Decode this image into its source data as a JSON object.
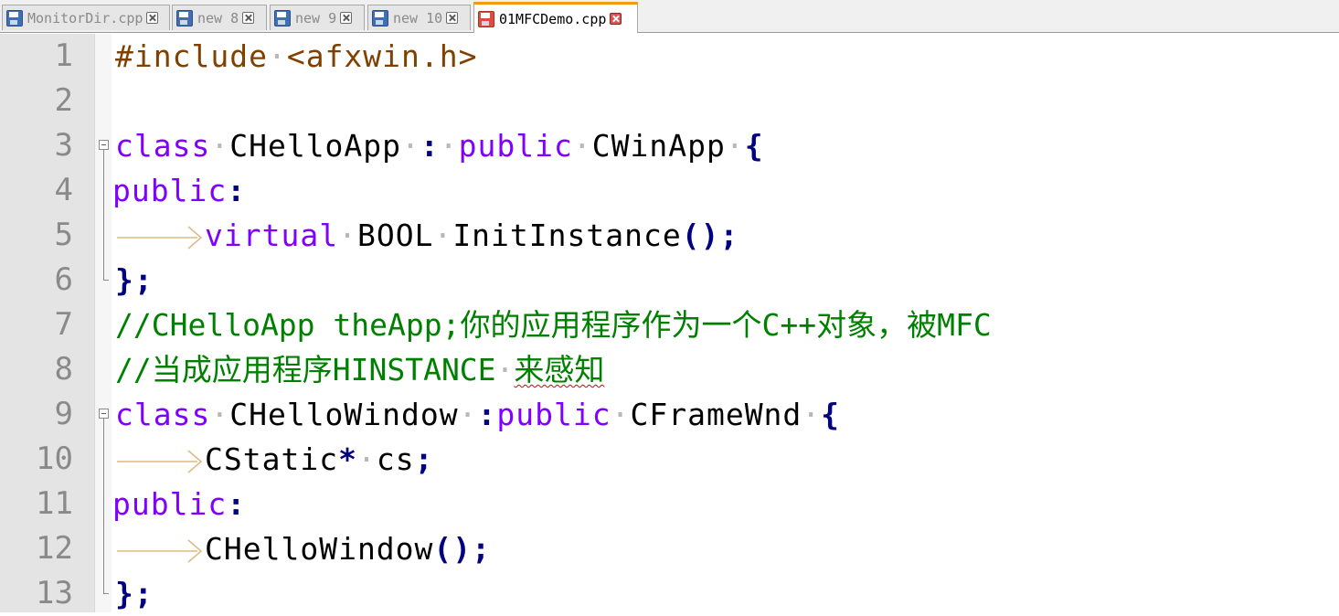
{
  "tabs": [
    {
      "label": "MonitorDir.cpp",
      "icon": "floppy-disk-icon",
      "active": false
    },
    {
      "label": "new 8",
      "icon": "floppy-disk-icon",
      "active": false
    },
    {
      "label": "new 9",
      "icon": "floppy-disk-icon",
      "active": false
    },
    {
      "label": "new 10",
      "icon": "floppy-disk-icon",
      "active": false
    },
    {
      "label": "01MFCDemo.cpp",
      "icon": "floppy-disk-unsaved-icon",
      "active": true
    }
  ],
  "editor": {
    "line_numbers": [
      "1",
      "2",
      "3",
      "4",
      "5",
      "6",
      "7",
      "8",
      "9",
      "10",
      "11",
      "12",
      "13"
    ],
    "line1": {
      "directive": "#include",
      "header": "<afxwin.h>"
    },
    "line3": {
      "kw_class": "class",
      "name": "CHelloApp",
      "colon": ":",
      "kw_public": "public",
      "base": "CWinApp",
      "brace": "{"
    },
    "line4": {
      "access": "public",
      "colon": ":"
    },
    "line5": {
      "kw_virtual": "virtual",
      "type": "BOOL",
      "func": "InitInstance",
      "parens": "()",
      "semi": ";"
    },
    "line6": {
      "close": "};"
    },
    "line7": {
      "comment": "//CHelloApp theApp;你的应用程序作为一个C++对象，被MFC"
    },
    "line8": {
      "comment_prefix": "//当成应用程序HINSTANCE",
      "comment_suffix": "来感知"
    },
    "line9": {
      "kw_class": "class",
      "name": "CHelloWindow",
      "colon": ":",
      "kw_public": "public",
      "base": "CFrameWnd",
      "brace": "{"
    },
    "line10": {
      "type": "CStatic",
      "star": "*",
      "var": "cs",
      "semi": ";"
    },
    "line11": {
      "access": "public",
      "colon": ":"
    },
    "line12": {
      "func": "CHelloWindow",
      "parens": "()",
      "semi": ";"
    },
    "line13": {
      "close": "};"
    }
  }
}
